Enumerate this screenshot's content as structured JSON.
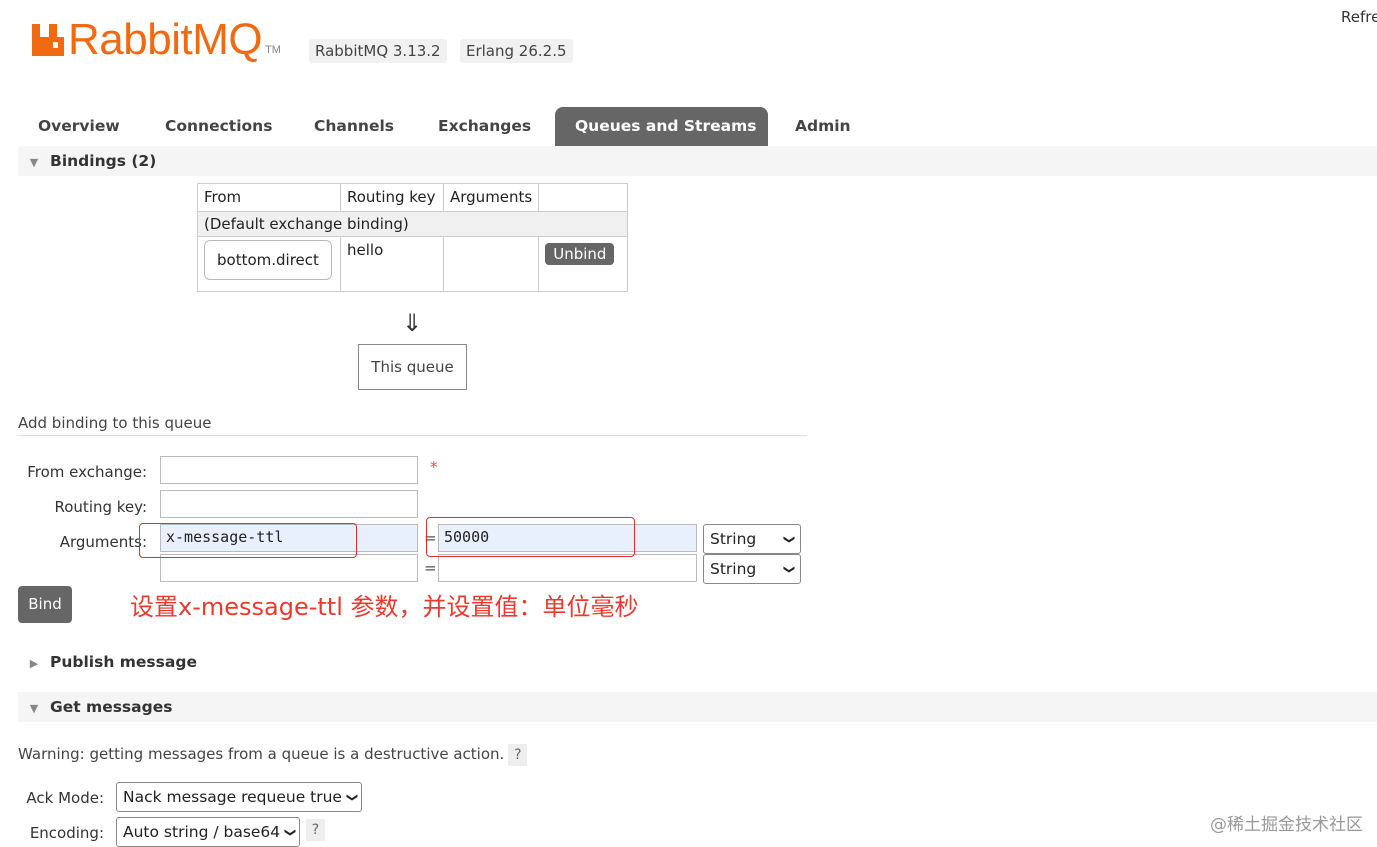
{
  "header": {
    "logo_text": "RabbitMQ",
    "logo_tm": "TM",
    "rabbitmq_version": "RabbitMQ 3.13.2",
    "erlang_version": "Erlang 26.2.5",
    "refresh_text": "Refre"
  },
  "nav": {
    "tabs": [
      {
        "label": "Overview"
      },
      {
        "label": "Connections"
      },
      {
        "label": "Channels"
      },
      {
        "label": "Exchanges"
      },
      {
        "label": "Queues and Streams",
        "active": true
      },
      {
        "label": "Admin"
      }
    ]
  },
  "bindings": {
    "title": "Bindings (2)",
    "columns": [
      "From",
      "Routing key",
      "Arguments",
      ""
    ],
    "default_row": "(Default exchange binding)",
    "row": {
      "from": "bottom.direct",
      "routing_key": "hello",
      "arguments": "",
      "unbind_label": "Unbind"
    },
    "arrow": "⇓",
    "this_queue": "This queue"
  },
  "add_binding": {
    "title": "Add binding to this queue",
    "from_label": "From exchange:",
    "from_value": "",
    "required_mark": "*",
    "routing_label": "Routing key:",
    "routing_value": "",
    "arguments_label": "Arguments:",
    "args": [
      {
        "key": "x-message-ttl",
        "value": "50000",
        "type": "String"
      },
      {
        "key": "",
        "value": "",
        "type": "String"
      }
    ],
    "equals": "=",
    "bind_label": "Bind",
    "annotation": "设置x-message-ttl 参数，并设置值：单位毫秒"
  },
  "publish": {
    "title": "Publish message"
  },
  "get_messages": {
    "title": "Get messages",
    "warning": "Warning: getting messages from a queue is a destructive action.",
    "help": "?",
    "ack_label": "Ack Mode:",
    "ack_value": "Nack message requeue true",
    "encoding_label": "Encoding:",
    "encoding_value": "Auto string / base64"
  },
  "watermark": "@稀土掘金技术社区",
  "colors": {
    "brand": "#f06a12",
    "annotation_red": "#e83a2e",
    "tab_active": "#666666"
  }
}
